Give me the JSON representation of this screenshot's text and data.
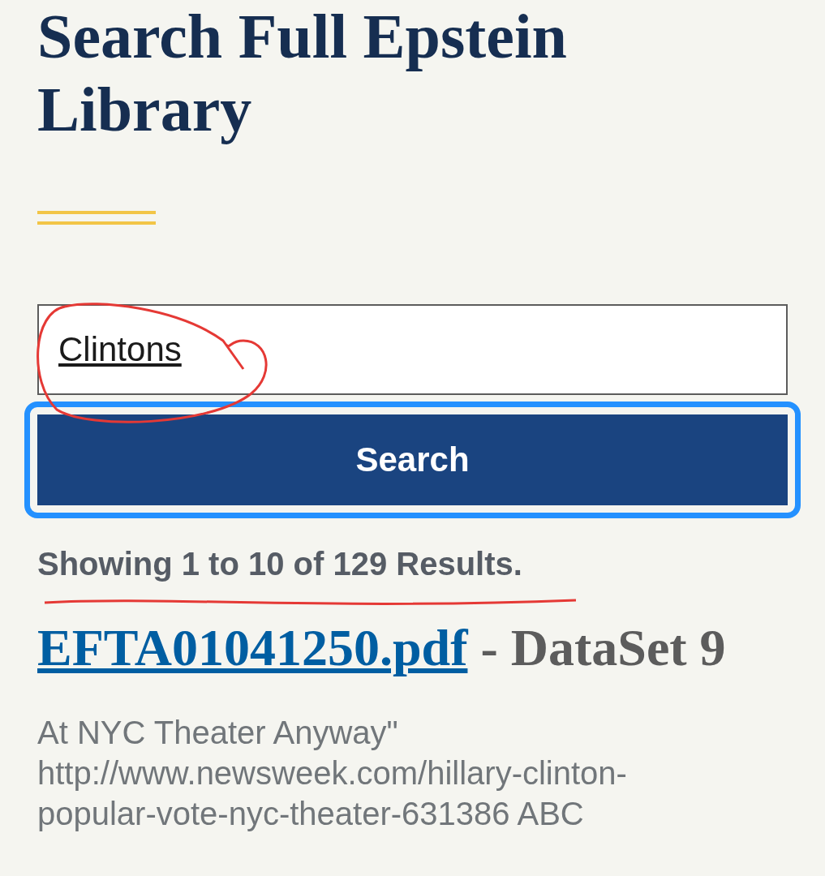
{
  "title": "Search Full Epstein Library",
  "search": {
    "value": "Clintons",
    "button": "Search",
    "focused": true
  },
  "results_summary": "Showing 1 to 10 of 129 Results.",
  "results": [
    {
      "file": "EFTA01041250.pdf",
      "dataset": "- DataSet 9",
      "snippet_lines": [
        "At NYC Theater Anyway\"",
        "http://www.newsweek.com/hillary-clinton-",
        "popular-vote-nyc-theater-631386 ABC"
      ]
    }
  ]
}
